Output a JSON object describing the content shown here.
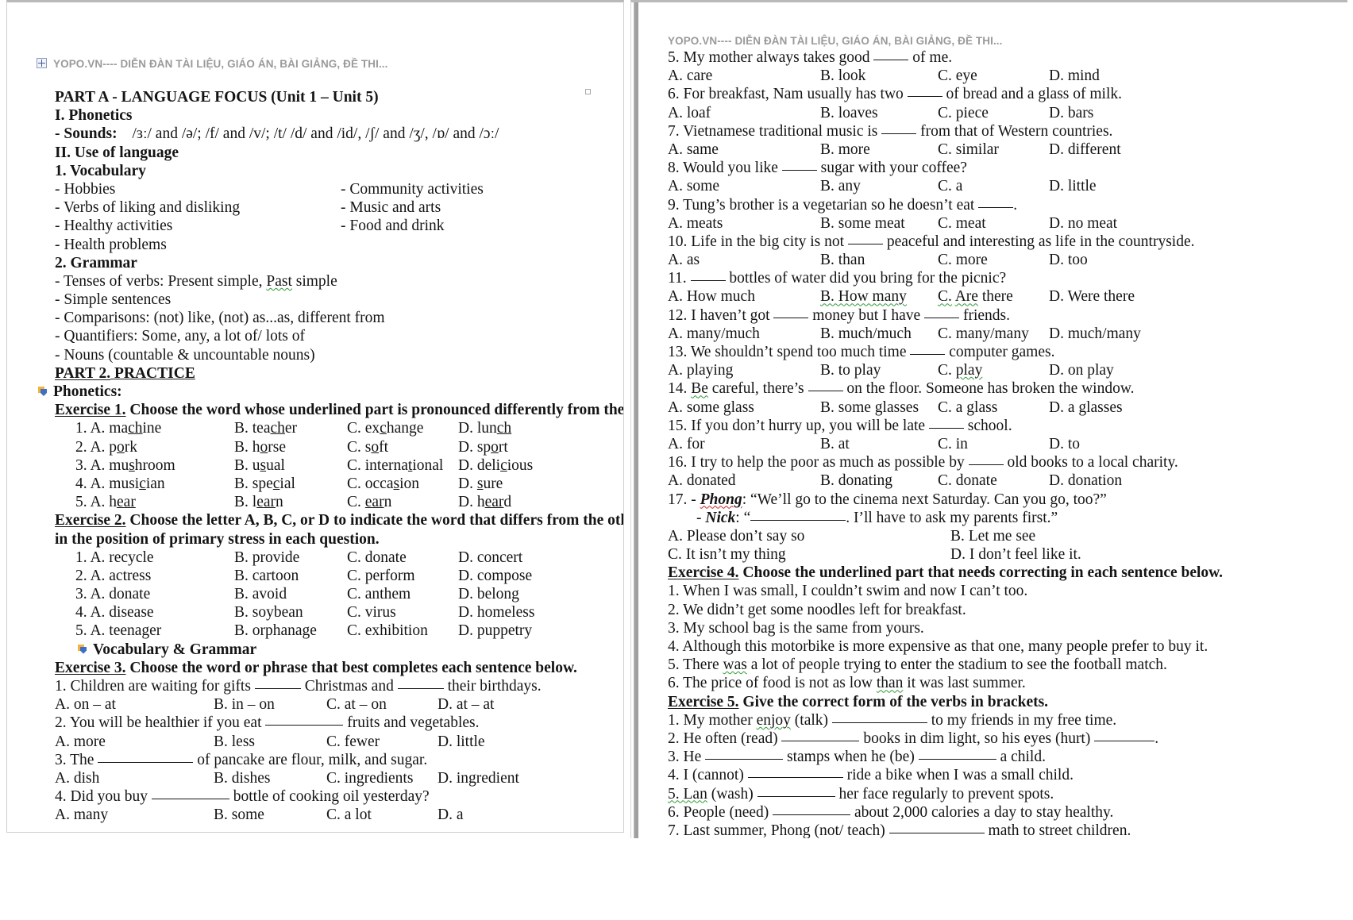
{
  "watermark": "YOPO.VN---- DIỄN ĐÀN TÀI LIỆU, GIÁO ÁN, BÀI GIẢNG, ĐỀ THI...",
  "left_page": {
    "part_a_title": "PART A - LANGUAGE FOCUS (Unit 1 – Unit 5)",
    "section_i": "I. Phonetics",
    "sounds_label": "- Sounds:",
    "sounds_value": "/ɜː/ and /ə/; /f/ and /v/; /t/ /d/ and /id/, /ʃ/ and /ʒ/, /ɒ/ and /ɔː/",
    "section_ii": "II. Use of language",
    "vocab_heading": "1. Vocabulary",
    "vocab_left": [
      "- Hobbies",
      "- Verbs of liking and disliking",
      "- Healthy activities",
      "- Health problems"
    ],
    "vocab_right": [
      "-  Community activities",
      "-  Music and arts",
      "-  Food and drink"
    ],
    "grammar_heading": "2. Grammar",
    "grammar_items": [
      "- Tenses of verbs: Present simple, ",
      "- Simple sentences",
      "- Comparisons: (not) like, (not) as...as, different from",
      "- Quantifiers: Some, any, a lot of/ lots of",
      "- Nouns (countable & uncountable nouns)"
    ],
    "grammar_tense_wavy": "Past",
    "grammar_tense_tail": " simple",
    "part_2_title_a": "PART 2.",
    "part_2_title_b": " PRACTICE",
    "phonetics_bullet": "Phonetics:",
    "exercise1": {
      "label": "Exercise 1.",
      "prompt": " Choose the word whose underlined part is pronounced differently from the others",
      "rows": [
        {
          "n": "1.",
          "a": [
            "A. ma",
            "ch",
            "ine"
          ],
          "b": [
            "B. tea",
            "ch",
            "er"
          ],
          "c": [
            "C. ex",
            "c",
            "hange"
          ],
          "d": [
            "D. lun",
            "ch",
            ""
          ]
        },
        {
          "n": "2.",
          "a": [
            "A. p",
            "o",
            "rk"
          ],
          "b": [
            "B. h",
            "o",
            "rse"
          ],
          "c": [
            "C. s",
            "o",
            "ft"
          ],
          "d": [
            "D. sp",
            "o",
            "rt"
          ]
        },
        {
          "n": "3.",
          "a": [
            "A. mu",
            "s",
            "hroom"
          ],
          "b": [
            "B. u",
            "s",
            "ual"
          ],
          "c": [
            "C. interna",
            "t",
            "ional"
          ],
          "d": [
            "D. deli",
            "c",
            "ious"
          ]
        },
        {
          "n": "4.",
          "a": [
            "A. musi",
            "c",
            "ian"
          ],
          "b": [
            "B. spe",
            "c",
            "ial"
          ],
          "c": [
            "C. occa",
            "s",
            "ion"
          ],
          "d": [
            "D. ",
            "s",
            "ure"
          ]
        },
        {
          "n": "5.",
          "a": [
            "A. h",
            "ear",
            ""
          ],
          "b": [
            "B. l",
            "ear",
            "n"
          ],
          "c": [
            "C. ",
            "ear",
            "n"
          ],
          "d": [
            "D. h",
            "ear",
            "d"
          ]
        }
      ]
    },
    "exercise2": {
      "label": "Exercise 2.",
      "prompt_line1": " Choose the letter A, B, C, or D to indicate the word that differs from the other three",
      "prompt_line2": "in the position of primary stress in each question.",
      "rows": [
        {
          "n": "1.",
          "a": "A. recycle",
          "b": "B. provide",
          "c": "C. donate",
          "d": "D. concert"
        },
        {
          "n": "2.",
          "a": "A. actress",
          "b": "B. cartoon",
          "c": "C. perform",
          "d": "D. compose"
        },
        {
          "n": "3.",
          "a": "A. donate",
          "b": "B. avoid",
          "c": "C. anthem",
          "d": "D. belong"
        },
        {
          "n": "4.",
          "a": "A. disease",
          "b": "B. soybean",
          "c": "C. virus",
          "d": "D. homeless"
        },
        {
          "n": "5.",
          "a": "A. teenager",
          "b": "B. orphanage",
          "c": "C. exhibition",
          "d": "D. puppetry"
        }
      ]
    },
    "vocab_grammar_bullet": "Vocabulary & Grammar",
    "exercise3": {
      "label": "Exercise 3.",
      "prompt": " Choose the word or phrase that best completes each sentence below.",
      "q1_p1": "1. Children are waiting for gifts ",
      "q1_p2": " Christmas and ",
      "q1_p3": " their birthdays.",
      "q1_opts": [
        "A. on – at",
        "B. in – on",
        "C. at – on",
        "D. at – at"
      ],
      "q2_p1": "2. You will be healthier if you eat ",
      "q2_p2": " fruits and vegetables.",
      "q2_opts": [
        "A. more",
        "B. less",
        "C. fewer",
        "D. little"
      ],
      "q3_p1": "3. The ",
      "q3_p2": " of pancake are flour, milk, and sugar.",
      "q3_opts": [
        "A. dish",
        "B. dishes",
        "C. ingredients",
        "D. ingredient"
      ],
      "q4_p1": "4. Did you buy ",
      "q4_p2": " bottle of cooking oil yesterday?",
      "q4_opts": [
        "A. many",
        "B. some",
        "C. a lot",
        "D. a"
      ]
    }
  },
  "right_page": {
    "exercise3_continued": [
      {
        "num": "5.",
        "pre": "5. My mother always takes good ",
        "post": " of me.",
        "blank": "md",
        "opts": [
          "A. care",
          "B. look",
          "C. eye",
          "D. mind"
        ]
      },
      {
        "num": "6.",
        "pre": "6. For breakfast, Nam usually has two ",
        "post": " of bread and a glass of milk.",
        "blank": "md",
        "opts": [
          "A. loaf",
          "B. loaves",
          "C. piece",
          "D. bars"
        ]
      },
      {
        "num": "7.",
        "pre": "7. Vietnamese traditional music is ",
        "post": " from that of Western countries.",
        "blank": "md",
        "opts": [
          "A. same",
          "B. more",
          "C. similar",
          "D. different"
        ]
      },
      {
        "num": "8.",
        "pre": "8. Would you like ",
        "post": " sugar with your coffee?",
        "blank": "md",
        "opts": [
          "A. some",
          "B. any",
          "C. a",
          "D. little"
        ]
      },
      {
        "num": "9.",
        "pre": "9. Tung’s brother is a vegetarian so he doesn’t eat ",
        "post": ".",
        "blank": "md",
        "opts": [
          "A. meats",
          "B. some meat",
          "C. meat",
          "D. no meat"
        ]
      },
      {
        "num": "10.",
        "pre": "10. Life in the big city is not ",
        "post": " peaceful and interesting as life in the countryside.",
        "blank": "md",
        "opts": [
          "A. as",
          "B. than",
          "C. more",
          "D. too"
        ]
      }
    ],
    "q11": {
      "pre": "11. ",
      "post": " bottles of water did you bring for the picnic?",
      "opt_a": "A. How much",
      "opt_b_wavy": "B. How many",
      "opt_c_wavy": "C.",
      "opt_c_rest_wavy": "Are",
      "opt_c_tail": " there",
      "opt_d": "D. Were there"
    },
    "q12": {
      "pre": "12. I haven’t got ",
      "mid": " money but I have ",
      "post": " friends.",
      "opts": [
        "A. many/much",
        "B. much/much",
        "C. many/many",
        "D. much/many"
      ]
    },
    "q13": {
      "pre": "13. We shouldn’t spend too much time ",
      "post": " computer games.",
      "opt_a": "A. playing",
      "opt_b": "B. to play",
      "opt_c_wavy": "C. play",
      "opt_d": "D. on play"
    },
    "q14": {
      "pre_wavy": "14. Be",
      "pre_rest": " careful, there’s ",
      "post": " on the floor. Someone has broken the window.",
      "opts": [
        "A. some glass",
        "B. some glasses",
        "C. a glass",
        "D. a glasses"
      ]
    },
    "q15": {
      "pre": "15. If you don’t hurry up, you will be late ",
      "post": " school.",
      "opts": [
        "A. for",
        "B. at",
        "C. in",
        "D. to"
      ]
    },
    "q16": {
      "pre": "16. I try to help the poor as much as possible by ",
      "post": " old books to a local charity.",
      "opts": [
        "A. donated",
        "B. donating",
        "C. donate",
        "D. donation"
      ]
    },
    "q17": {
      "num": "17. - ",
      "speaker1": "Phong",
      "line1": ": “We’ll go to the cinema next Saturday. Can you go, too?”",
      "dash2": "- ",
      "speaker2": "Nick",
      "line2_pre": ": “",
      "line2_post": ". I’ll have to ask my parents first.”",
      "opt_a": "A. Please don’t say so",
      "opt_b": "B. Let me see",
      "opt_c": "C. It isn’t my thing",
      "opt_d": "D. I don’t feel like it."
    },
    "exercise4": {
      "label": "Exercise 4.",
      "prompt": " Choose the underlined part that needs correcting in each sentence below.",
      "items": [
        "1. When I was small, I couldn’t swim and now I can’t too.",
        "2. We didn’t get some noodles left for breakfast.",
        "3. My school bag is the same from yours.",
        "4. Although this motorbike is more expensive as that one, many people prefer to buy it.",
        "5. There was a lot of people trying to enter the stadium to see the football match.",
        "6. The price of food is not as low than it was last summer."
      ],
      "item5_pre": "5. There ",
      "item5_wavy": "was",
      "item5_post": " a lot of people trying to enter the stadium to see the football match.",
      "item6_pre": "6. The price of food is not as low ",
      "item6_wavy": "than",
      "item6_post": " it was last summer."
    },
    "exercise5": {
      "label": "Exercise 5.",
      "prompt": " Give the correct form of the verbs in brackets.",
      "q1_p1": "1. My mother ",
      "q1_wavy": "enjoy",
      "q1_p2": " (talk) ",
      "q1_p3": " to my friends in my free time.",
      "q2_p1": "2. He often (read) ",
      "q2_p2": " books in dim light, so his eyes (hurt) ",
      "q2_p3": ".",
      "q3_p1": "3. He ",
      "q3_p2": " stamps when he (be) ",
      "q3_p3": " a child.",
      "q4_p1": "4. I (cannot) ",
      "q4_p2": " ride a bike when I was a small child.",
      "q5_wavy": "5. Lan",
      "q5_p1": " (wash) ",
      "q5_p2": " her face regularly to prevent spots.",
      "q6_p1": "6. People (need) ",
      "q6_p2": " about 2,000 calories a day to stay healthy.",
      "q7_p1": "7. Last summer, Phong (not/ teach) ",
      "q7_p2": " math to street children."
    }
  }
}
